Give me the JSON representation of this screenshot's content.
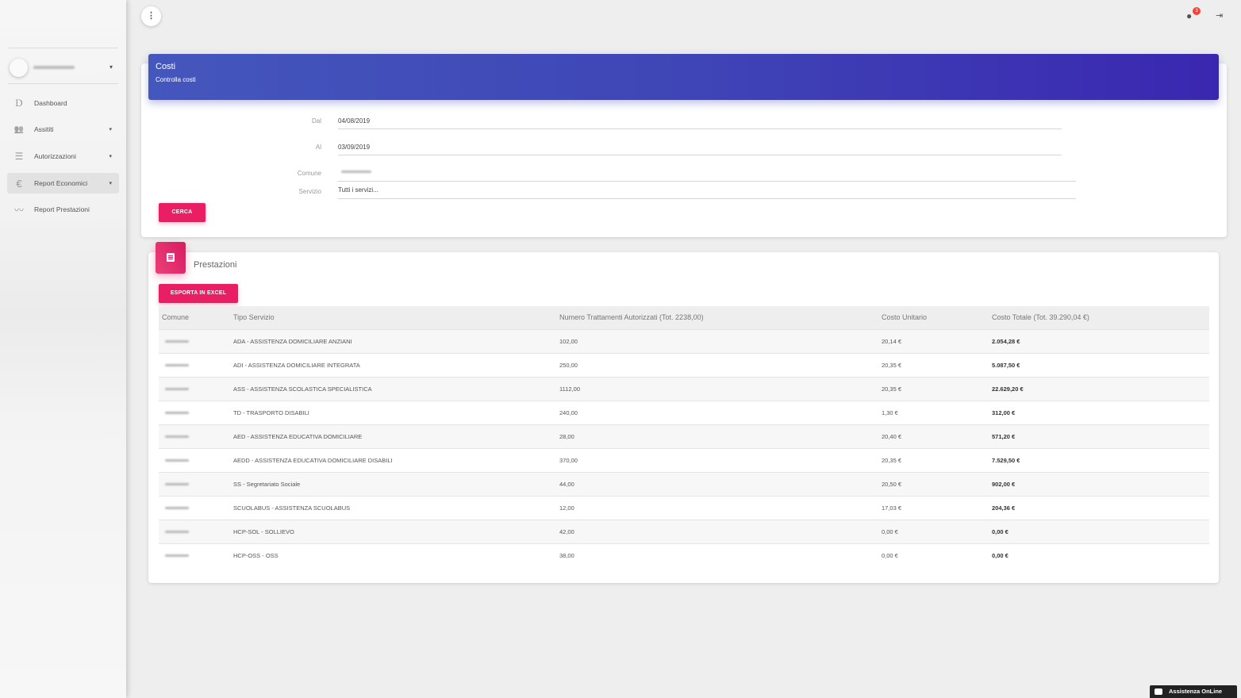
{
  "sidebar": {
    "user_caret": "▾",
    "items": [
      {
        "icon": "D",
        "label": "Dashboard",
        "has_caret": false
      },
      {
        "icon": "👥",
        "label": "Assititi",
        "has_caret": true
      },
      {
        "icon": "☰",
        "label": "Autorizzazioni",
        "has_caret": true
      },
      {
        "icon": "€",
        "label": "Report Economici",
        "has_caret": true
      },
      {
        "icon": "〰",
        "label": "Report Prestazioni",
        "has_caret": false
      }
    ]
  },
  "topbar": {
    "menu_icon": "⋮",
    "notification_count": "3",
    "bell_icon": "🔔",
    "logout_icon": "⇥"
  },
  "costi": {
    "title": "Costi",
    "subtitle": "Controlla costi",
    "fields": {
      "dal_label": "Dal",
      "dal_value": "04/08/2019",
      "al_label": "Al",
      "al_value": "03/09/2019",
      "comune_label": "Comune",
      "servizio_label": "Servizio",
      "servizio_value": "Tutti i servizi..."
    },
    "search_button": "CERCA"
  },
  "prestazioni": {
    "title": "Prestazioni",
    "export_button": "ESPORTA IN EXCEL",
    "columns": [
      "Comune",
      "Tipo Servizio",
      "Numero Trattamenti Autorizzati (Tot. 2238,00)",
      "Costo Unitario",
      "Costo Totale (Tot. 39.290,04 €)"
    ],
    "rows": [
      {
        "tipo": "ADA - ASSISTENZA DOMICILIARE ANZIANI",
        "numero": "102,00",
        "unitario": "20,14 €",
        "totale": "2.054,28 €"
      },
      {
        "tipo": "ADI - ASSISTENZA DOMICILIARE INTEGRATA",
        "numero": "250,00",
        "unitario": "20,35 €",
        "totale": "5.087,50 €"
      },
      {
        "tipo": "ASS - ASSISTENZA SCOLASTICA SPECIALISTICA",
        "numero": "1112,00",
        "unitario": "20,35 €",
        "totale": "22.629,20 €"
      },
      {
        "tipo": "TD - TRASPORTO DISABILI",
        "numero": "240,00",
        "unitario": "1,30 €",
        "totale": "312,00 €"
      },
      {
        "tipo": "AED - ASSISTENZA EDUCATIVA DOMICILIARE",
        "numero": "28,00",
        "unitario": "20,40 €",
        "totale": "571,20 €"
      },
      {
        "tipo": "AEDD - ASSISTENZA EDUCATIVA DOMICILIARE DISABILI",
        "numero": "370,00",
        "unitario": "20,35 €",
        "totale": "7.529,50 €"
      },
      {
        "tipo": "SS - Segretariato Sociale",
        "numero": "44,00",
        "unitario": "20,50 €",
        "totale": "902,00 €"
      },
      {
        "tipo": "SCUOLABUS - ASSISTENZA SCUOLABUS",
        "numero": "12,00",
        "unitario": "17,03 €",
        "totale": "204,36 €"
      },
      {
        "tipo": "HCP-SOL - SOLLIEVO",
        "numero": "42,00",
        "unitario": "0,00 €",
        "totale": "0,00 €"
      },
      {
        "tipo": "HCP-OSS - OSS",
        "numero": "38,00",
        "unitario": "0,00 €",
        "totale": "0,00 €"
      }
    ]
  },
  "chat": {
    "label": "Assistenza OnLine"
  },
  "colors": {
    "accent": "#e91e63",
    "header_start": "#4457bd",
    "header_end": "#3a27b1"
  }
}
